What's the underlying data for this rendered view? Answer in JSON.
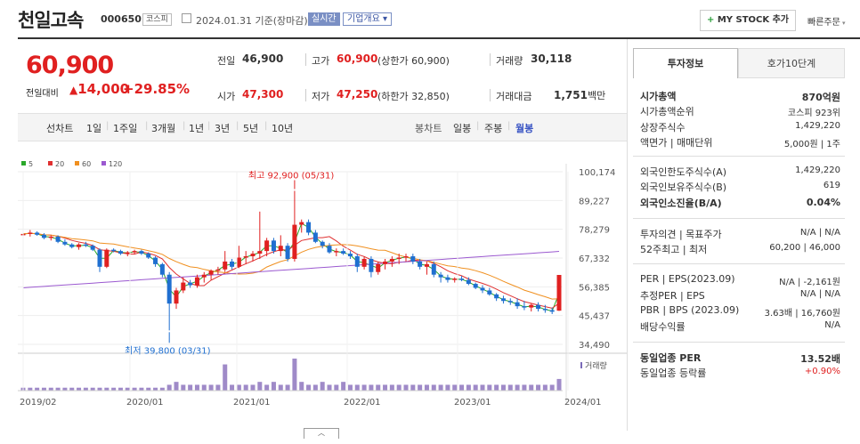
{
  "header": {
    "name": "천일고속",
    "code": "000650",
    "market": "코스피",
    "date_note": "2024.01.31 기준(장마감)",
    "realtime": "실시간",
    "company_btn": "기업개요",
    "my_stock": "MY STOCK 추가",
    "quick_order": "빠른주문"
  },
  "quote": {
    "price": "60,900",
    "change_label": "전일대비",
    "change": "14,000",
    "rate": "+29.85%",
    "prev_label": "전일",
    "prev": "46,900",
    "high_label": "고가",
    "high": "60,900",
    "high_note": "(상한가 60,900)",
    "volume_label": "거래량",
    "volume": "30,118",
    "open_label": "시가",
    "open": "47,300",
    "low_label": "저가",
    "low": "47,250",
    "low_note": "(하한가 32,850)",
    "amount_label": "거래대금",
    "amount": "1,751",
    "amount_unit": "백만"
  },
  "toolbar": {
    "line_label": "선차트",
    "periods": [
      "1일",
      "1주일",
      "3개월",
      "1년",
      "3년",
      "5년",
      "10년"
    ],
    "candle_label": "봉차트",
    "candles": [
      "일봉",
      "주봉",
      "월봉"
    ]
  },
  "chart_data": {
    "type": "candlestick",
    "ylim": [
      34490,
      100174
    ],
    "yticks": [
      "100,174",
      "89,227",
      "78,279",
      "67,332",
      "56,385",
      "45,437",
      "34,490"
    ],
    "xticks": [
      "2019/02",
      "2020/01",
      "2021/01",
      "2022/01",
      "2023/01",
      "2024/01"
    ],
    "legend": [
      {
        "name": "5",
        "color": "#2aa82a"
      },
      {
        "name": "20",
        "color": "#e03030"
      },
      {
        "name": "60",
        "color": "#f09020"
      },
      {
        "name": "120",
        "color": "#9b59d0"
      }
    ],
    "annotations": {
      "high": "최고 92,900 (05/31)",
      "low": "최저 39,800 (03/31)"
    },
    "volume_label": "거래량",
    "candles": [
      [
        76000,
        77000,
        75000,
        76500
      ],
      [
        76500,
        78000,
        75500,
        77000
      ],
      [
        77000,
        77500,
        75800,
        76200
      ],
      [
        76200,
        76800,
        74500,
        75000
      ],
      [
        75000,
        76000,
        74000,
        75500
      ],
      [
        75500,
        76000,
        73000,
        73500
      ],
      [
        73500,
        74500,
        72000,
        72500
      ],
      [
        72500,
        73000,
        71000,
        71500
      ],
      [
        71500,
        73000,
        70500,
        72500
      ],
      [
        72500,
        73500,
        71500,
        72000
      ],
      [
        72000,
        72500,
        70000,
        70500
      ],
      [
        70500,
        71000,
        62000,
        64000
      ],
      [
        64000,
        71000,
        63500,
        70500
      ],
      [
        70500,
        71000,
        69500,
        70000
      ],
      [
        70000,
        70500,
        68500,
        69000
      ],
      [
        69000,
        70000,
        68000,
        69500
      ],
      [
        69500,
        70500,
        68800,
        70000
      ],
      [
        70000,
        70500,
        68500,
        69000
      ],
      [
        69000,
        69500,
        67000,
        67500
      ],
      [
        67500,
        68000,
        64000,
        65000
      ],
      [
        65000,
        65500,
        60000,
        61000
      ],
      [
        61000,
        62000,
        39800,
        50000
      ],
      [
        50000,
        56000,
        48000,
        55000
      ],
      [
        55000,
        60000,
        54000,
        58000
      ],
      [
        58000,
        59000,
        56000,
        57000
      ],
      [
        57000,
        61000,
        56000,
        60000
      ],
      [
        60000,
        62000,
        58000,
        61000
      ],
      [
        61000,
        63000,
        59000,
        62500
      ],
      [
        62500,
        64000,
        61000,
        63000
      ],
      [
        63000,
        70000,
        62000,
        66000
      ],
      [
        66000,
        67000,
        63000,
        64000
      ],
      [
        64000,
        72000,
        63500,
        67500
      ],
      [
        67500,
        70000,
        65000,
        68000
      ],
      [
        68000,
        70000,
        66000,
        69000
      ],
      [
        69000,
        85000,
        67000,
        70000
      ],
      [
        70000,
        75000,
        68000,
        74000
      ],
      [
        74000,
        75000,
        69000,
        70000
      ],
      [
        70000,
        76000,
        68000,
        72000
      ],
      [
        72000,
        73000,
        66000,
        67000
      ],
      [
        67000,
        92900,
        66000,
        80000
      ],
      [
        80000,
        82000,
        77000,
        81000
      ],
      [
        81000,
        82000,
        76000,
        77000
      ],
      [
        77000,
        78000,
        73000,
        73500
      ],
      [
        73500,
        74000,
        71000,
        72000
      ],
      [
        72000,
        73000,
        69000,
        69500
      ],
      [
        69500,
        71000,
        68000,
        70000
      ],
      [
        70000,
        71000,
        68500,
        69000
      ],
      [
        69000,
        70000,
        67000,
        68000
      ],
      [
        68000,
        69000,
        62000,
        64000
      ],
      [
        64000,
        68000,
        63000,
        67000
      ],
      [
        67000,
        68000,
        60000,
        62000
      ],
      [
        62000,
        66000,
        61000,
        65000
      ],
      [
        65000,
        67000,
        63000,
        66000
      ],
      [
        66000,
        68000,
        64000,
        67000
      ],
      [
        67000,
        69000,
        65000,
        67500
      ],
      [
        67500,
        69000,
        66000,
        68000
      ],
      [
        68000,
        69000,
        65000,
        66000
      ],
      [
        66000,
        67000,
        63000,
        64000
      ],
      [
        64000,
        66000,
        61000,
        65000
      ],
      [
        65000,
        66000,
        60000,
        61000
      ],
      [
        61000,
        62000,
        58000,
        60000
      ],
      [
        60000,
        61000,
        58000,
        59000
      ],
      [
        59000,
        60000,
        58000,
        59500
      ],
      [
        59500,
        60500,
        58500,
        59000
      ],
      [
        59000,
        60000,
        57000,
        57500
      ],
      [
        57500,
        58000,
        55500,
        56000
      ],
      [
        56000,
        57000,
        54000,
        55000
      ],
      [
        55000,
        56000,
        53000,
        53500
      ],
      [
        53500,
        54000,
        51000,
        52000
      ],
      [
        52000,
        53000,
        50000,
        51000
      ],
      [
        51000,
        52000,
        49500,
        50500
      ],
      [
        50500,
        52000,
        48000,
        49000
      ],
      [
        49000,
        51000,
        47500,
        48500
      ],
      [
        48500,
        50000,
        47000,
        49500
      ],
      [
        49500,
        50500,
        47000,
        48000
      ],
      [
        48000,
        49500,
        46500,
        47500
      ],
      [
        47500,
        48500,
        46000,
        46900
      ],
      [
        47300,
        60900,
        47250,
        60900
      ]
    ],
    "volumes": [
      1,
      1,
      1,
      1,
      1,
      1,
      1,
      1,
      1,
      1,
      1,
      1,
      1,
      1,
      1,
      1,
      1,
      1,
      1,
      1,
      1,
      2,
      3,
      2,
      2,
      2,
      2,
      2,
      2,
      9,
      2,
      2,
      2,
      2,
      3,
      2,
      3,
      2,
      2,
      11,
      3,
      2,
      2,
      3,
      2,
      2,
      3,
      2,
      2,
      2,
      2,
      2,
      2,
      2,
      2,
      2,
      2,
      2,
      2,
      2,
      2,
      2,
      2,
      2,
      2,
      2,
      2,
      2,
      2,
      2,
      2,
      2,
      2,
      2,
      2,
      2,
      2,
      4
    ]
  },
  "panel": {
    "tab_invest": "투자정보",
    "tab_hoga": "호가10단계",
    "rows1": [
      {
        "label": "시가총액",
        "value": "870억원",
        "bold": true
      },
      {
        "label": "시가총액순위",
        "value": "코스피 923위"
      },
      {
        "label": "상장주식수",
        "value": "1,429,220"
      },
      {
        "label": "액면가 | 매매단위",
        "value": "5,000원 | 1주"
      }
    ],
    "rows2": [
      {
        "label": "외국인한도주식수(A)",
        "value": "1,429,220"
      },
      {
        "label": "외국인보유주식수(B)",
        "value": "619"
      },
      {
        "label": "외국인소진율(B/A)",
        "value": "0.04%",
        "bold": true
      }
    ],
    "rows3": [
      {
        "label": "투자의견 | 목표주가",
        "value": "N/A | N/A"
      },
      {
        "label": "52주최고 | 최저",
        "value": "60,200 | 46,000"
      }
    ],
    "rows4": [
      {
        "label": "PER | EPS(2023.09)",
        "value": "N/A | -2,161원"
      },
      {
        "label": "추정PER | EPS",
        "value": "N/A | N/A"
      },
      {
        "label": "PBR | BPS (2023.09)",
        "value": "3.63배 | 16,760원"
      },
      {
        "label": "배당수익률",
        "value": "N/A"
      }
    ],
    "rows5": [
      {
        "label": "동일업종 PER",
        "value": "13.52배",
        "bold": true
      },
      {
        "label": "동일업종 등락률",
        "value": "+0.90%",
        "red": true
      }
    ]
  }
}
